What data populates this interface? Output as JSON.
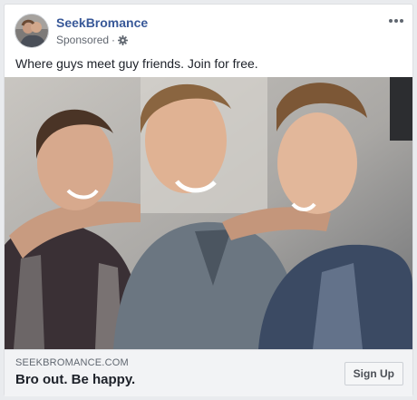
{
  "post": {
    "page_name": "SeekBromance",
    "sponsored_label": "Sponsored",
    "sponsored_separator": "·",
    "caption": "Where guys meet guy friends. Join for free.",
    "avatar_icon": "avatar-photo-icon",
    "privacy_icon": "gear-icon",
    "more_icon": "more-options-icon"
  },
  "link_preview": {
    "domain": "SEEKBROMANCE.COM",
    "headline": "Bro out. Be happy.",
    "cta_label": "Sign Up"
  },
  "colors": {
    "page_bg": "#e9ebee",
    "link_blue": "#385898",
    "footer_bg": "#f2f3f5"
  }
}
